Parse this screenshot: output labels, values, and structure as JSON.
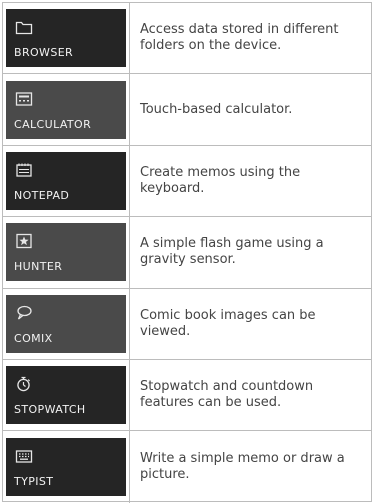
{
  "apps": [
    {
      "label": "BROWSER",
      "icon": "folder-icon",
      "description": "Access data stored in different folders on the device."
    },
    {
      "label": "CALCULATOR",
      "icon": "calculator-icon",
      "description": "Touch-based calculator."
    },
    {
      "label": "NOTEPAD",
      "icon": "notepad-icon",
      "description": "Create memos using the keyboard."
    },
    {
      "label": "HUNTER",
      "icon": "target-game-icon",
      "description": "A simple flash game using a gravity sensor."
    },
    {
      "label": "COMIX",
      "icon": "speech-bubble-icon",
      "description": "Comic book images can be viewed."
    },
    {
      "label": "STOPWATCH",
      "icon": "stopwatch-icon",
      "description": "Stopwatch and countdown features can be used."
    },
    {
      "label": "TYPIST",
      "icon": "keyboard-icon",
      "description": "Write a simple memo or draw a picture."
    }
  ]
}
